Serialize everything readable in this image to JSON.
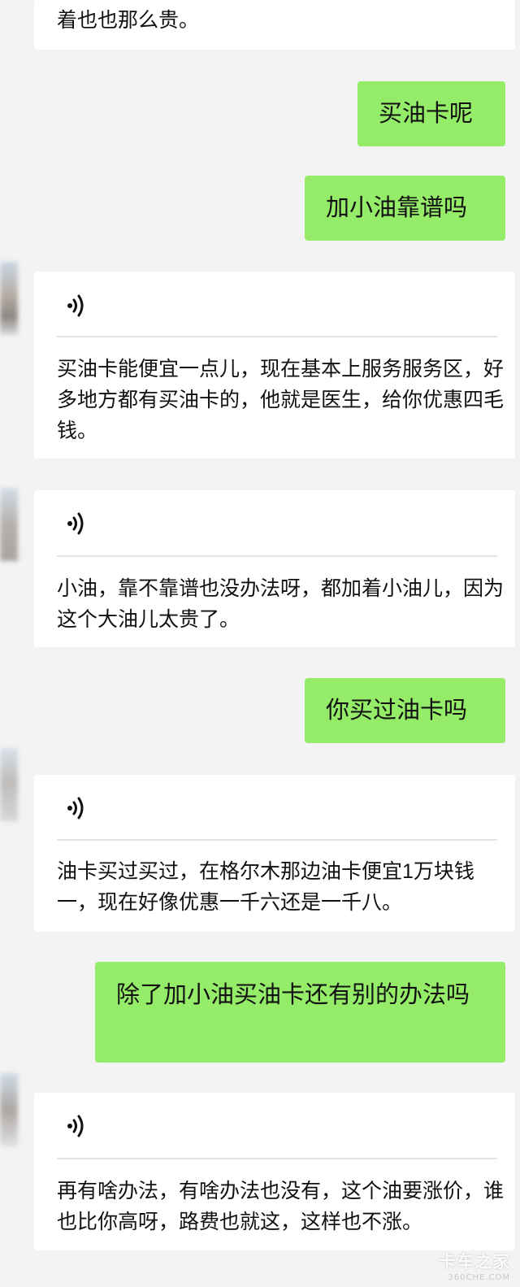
{
  "messages": {
    "m0": {
      "text": "着也也那么贵。"
    },
    "m1": {
      "text": "买油卡呢"
    },
    "m2": {
      "text": "加小油靠谱吗"
    },
    "m3": {
      "transcript": "买油卡能便宜一点儿，现在基本上服务服务区，好多地方都有买油卡的，他就是医生，给你优惠四毛钱。"
    },
    "m4": {
      "transcript": "小油，靠不靠谱也没办法呀，都加着小油儿，因为这个大油儿太贵了。"
    },
    "m5": {
      "text": "你买过油卡吗"
    },
    "m6": {
      "transcript": "油卡买过买过，在格尔木那边油卡便宜1万块钱一，现在好像优惠一千六还是一千八。"
    },
    "m7": {
      "text": "除了加小油买油卡还有别的办法吗"
    },
    "m8": {
      "transcript": "再有啥办法，有啥办法也没有，这个油要涨价，谁也比你高呀，路费也就这，这样也不涨。"
    }
  },
  "watermark": {
    "main": "卡车之家",
    "sub": "360CHE.COM"
  },
  "colors": {
    "background": "#f3f3f3",
    "incoming_bubble": "#ffffff",
    "outgoing_bubble": "#95ec69"
  },
  "icons": {
    "voice": "voice-wave-icon"
  }
}
